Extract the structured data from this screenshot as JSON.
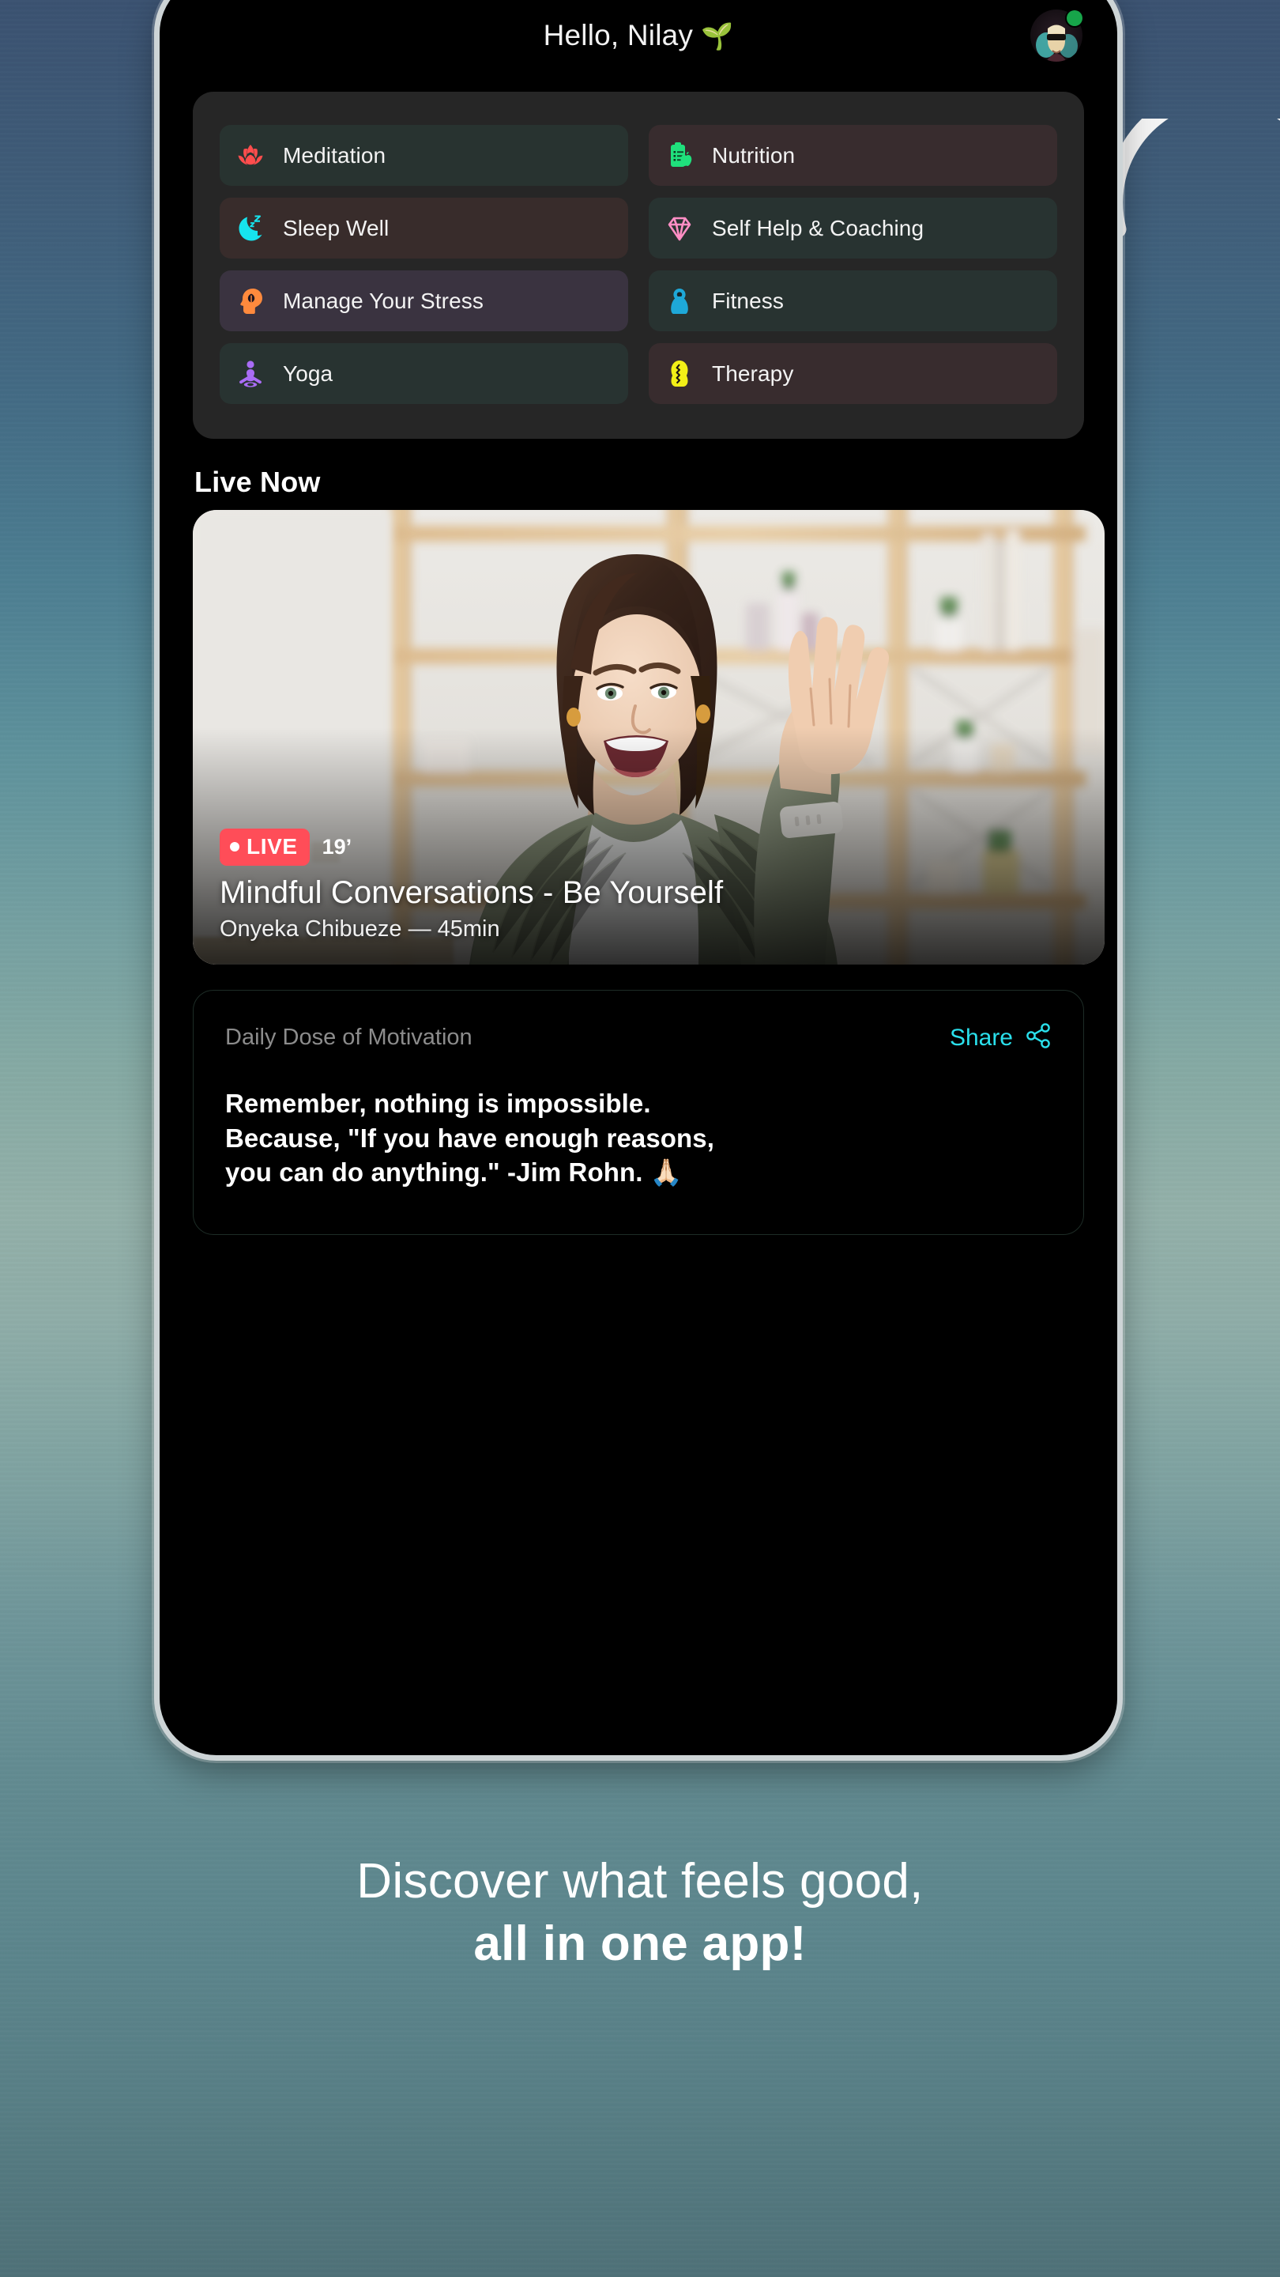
{
  "phone": {
    "header": {
      "greeting": "Hello, Nilay",
      "greeting_emoji": "🌱",
      "avatar_name": "user-avatar",
      "status": "online"
    },
    "categories": [
      {
        "label": "Meditation",
        "icon": "lotus-icon",
        "icon_color": "#ff4d4d",
        "tile_bg": "#283330"
      },
      {
        "label": "Nutrition",
        "icon": "clipboard-apple-icon",
        "icon_color": "#1fe07c",
        "tile_bg": "#382c2e"
      },
      {
        "label": "Sleep Well",
        "icon": "moon-zzz-icon",
        "icon_color": "#16e4ee",
        "tile_bg": "#382c2b"
      },
      {
        "label": "Self Help & Coaching",
        "icon": "diamond-icon",
        "icon_color": "#ff8ec4",
        "tile_bg": "#283331"
      },
      {
        "label": "Manage Your Stress",
        "icon": "head-leaf-icon",
        "icon_color": "#ff8a3d",
        "tile_bg": "#3a3340"
      },
      {
        "label": "Fitness",
        "icon": "kettlebell-icon",
        "icon_color": "#1ea8d8",
        "tile_bg": "#283331"
      },
      {
        "label": "Yoga",
        "icon": "yoga-pose-icon",
        "icon_color": "#a96cf5",
        "tile_bg": "#283331"
      },
      {
        "label": "Therapy",
        "icon": "brain-puzzle-icon",
        "icon_color": "#f2ef17",
        "tile_bg": "#382c2e"
      }
    ],
    "live_section": {
      "title": "Live Now",
      "card": {
        "badge": "LIVE",
        "elapsed": "19’",
        "title": "Mindful Conversations - Be Yourself",
        "subtitle": "Onyeka Chibueze — 45min",
        "badge_color": "#ff4d58",
        "image_alt": "smiling-woman-waving-on-video-call"
      }
    },
    "quote_card": {
      "title": "Daily Dose of Motivation",
      "share_label": "Share",
      "share_icon": "share-nodes-icon",
      "share_color": "#2ae0ec",
      "quote": "Remember, nothing is impossible. Because, \"If you have enough reasons, you can do anything.\" -Jim Rohn.",
      "quote_line_1": "Remember, nothing is impossible.",
      "quote_line_2": "Because, \"If you have enough reasons,",
      "quote_line_3": "you can do anything.\" -Jim Rohn.",
      "quote_emoji": "🙏🏻"
    }
  },
  "tagline": {
    "line1": "Discover what feels good,",
    "line2": "all in one app!"
  }
}
